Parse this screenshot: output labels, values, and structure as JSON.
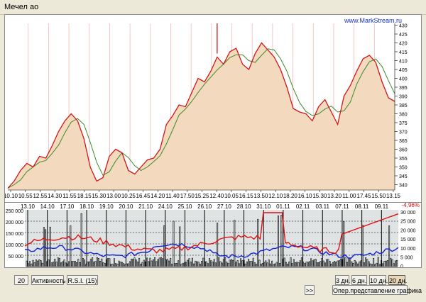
{
  "window": {
    "title": "Мечел ао"
  },
  "chart": {
    "watermark": "www.MarkStream.ru",
    "percent_change": "-4,96%",
    "top_date_labels": [
      "13.10",
      "14.10",
      "17.10",
      "18.10",
      "19.10",
      "20.10",
      "21.10",
      "24.10",
      "25.10",
      "26.10",
      "27.10",
      "28.10",
      "31.10",
      "01.11",
      "02.11",
      "03.11",
      "07.11",
      "08.11",
      "09.11"
    ],
    "time_labels": [
      "10.10",
      "10.55",
      "12.55",
      "14.30",
      "11.55",
      "18.15",
      "15.30",
      "13.00",
      "10.25",
      "16.45",
      "14.20",
      "11.40",
      "17.50",
      "15.25",
      "12.40",
      "10.05",
      "16.15",
      "13.50",
      "12.10",
      "18.20",
      "16.10",
      "15.30",
      "13.20",
      "11.00",
      "17.45",
      "15.50",
      "13.15"
    ],
    "volume_axis_labels": [
      "250 000",
      "200 000",
      "150 000",
      "100 000",
      "50 000"
    ],
    "oscillator_axis_labels": [
      "30 000",
      "25 000",
      "20 000",
      "15 000",
      "10 000",
      "5 000",
      "0"
    ]
  },
  "chart_data": {
    "type": "line",
    "ylim": [
      337,
      431
    ],
    "price_ticks": [
      430,
      425,
      420,
      415,
      410,
      405,
      400,
      395,
      390,
      385,
      380,
      375,
      370,
      365,
      360,
      355,
      350,
      345,
      340
    ],
    "price_series": [
      338,
      342,
      348,
      352,
      350,
      356,
      355,
      362,
      370,
      376,
      380,
      376,
      366,
      350,
      342,
      344,
      356,
      360,
      358,
      348,
      346,
      350,
      354,
      355,
      360,
      374,
      379,
      385,
      384,
      392,
      400,
      398,
      404,
      412,
      408,
      415,
      417,
      408,
      405,
      414,
      420,
      416,
      412,
      405,
      395,
      383,
      381,
      380,
      376,
      384,
      388,
      381,
      374,
      390,
      396,
      404,
      411,
      413,
      409,
      398,
      389,
      387
    ]
  },
  "controls": {
    "period_value": "20",
    "activity_label": "Активность",
    "rsi_label": "R.S.I. (15)",
    "nav_label": ">>",
    "range_3d": "3 дн.",
    "range_6d": "6 дн.",
    "range_10d": "10 дн.",
    "range_20d": "20 дн.",
    "operative_chart_label": "Опер.представление графика"
  }
}
